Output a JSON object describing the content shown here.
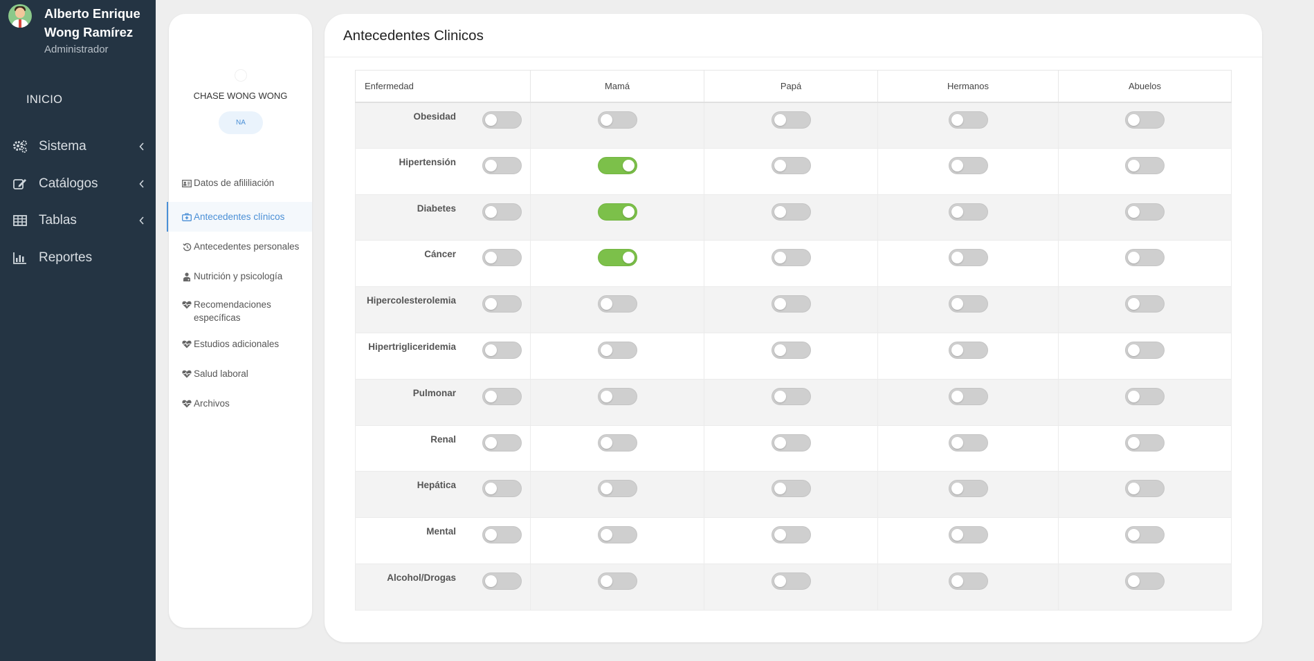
{
  "user": {
    "name": "Alberto Enrique Wong Ramírez",
    "role": "Administrador"
  },
  "nav": {
    "inicio": "INICIO",
    "items": [
      {
        "label": "Sistema",
        "icon": "cogs-icon"
      },
      {
        "label": "Catálogos",
        "icon": "edit-icon"
      },
      {
        "label": "Tablas",
        "icon": "table-icon"
      },
      {
        "label": "Reportes",
        "icon": "bar-chart-icon"
      }
    ]
  },
  "patient": {
    "name": "CHASE WONG WONG",
    "badge": "NA",
    "menu": [
      {
        "label": "Datos de afililiación",
        "icon": "id-card-icon",
        "active": false
      },
      {
        "label": "Antecedentes clínicos",
        "icon": "medkit-icon",
        "active": true
      },
      {
        "label": "Antecedentes personales",
        "icon": "history-icon",
        "active": false
      },
      {
        "label": "Nutrición y psicología",
        "icon": "doctor-icon",
        "active": false
      },
      {
        "label": "Recomendaciones específicas",
        "icon": "heartbeat-icon",
        "active": false
      },
      {
        "label": "Estudios adicionales",
        "icon": "heartbeat-icon",
        "active": false
      },
      {
        "label": "Salud laboral",
        "icon": "heartbeat-icon",
        "active": false
      },
      {
        "label": "Archivos",
        "icon": "heartbeat-icon",
        "active": false
      }
    ]
  },
  "main": {
    "title": "Antecedentes Clinicos",
    "columns": [
      "Enfermedad",
      "Mamá",
      "Papá",
      "Hermanos",
      "Abuelos"
    ],
    "rows": [
      {
        "name": "Obesidad",
        "self": false,
        "mama": false,
        "papa": false,
        "hermanos": false,
        "abuelos": false
      },
      {
        "name": "Hipertensión",
        "self": false,
        "mama": true,
        "papa": false,
        "hermanos": false,
        "abuelos": false
      },
      {
        "name": "Diabetes",
        "self": false,
        "mama": true,
        "papa": false,
        "hermanos": false,
        "abuelos": false
      },
      {
        "name": "Cáncer",
        "self": false,
        "mama": true,
        "papa": false,
        "hermanos": false,
        "abuelos": false
      },
      {
        "name": "Hipercolesterolemia",
        "self": false,
        "mama": false,
        "papa": false,
        "hermanos": false,
        "abuelos": false
      },
      {
        "name": "Hipertrigliceridemia",
        "self": false,
        "mama": false,
        "papa": false,
        "hermanos": false,
        "abuelos": false
      },
      {
        "name": "Pulmonar",
        "self": false,
        "mama": false,
        "papa": false,
        "hermanos": false,
        "abuelos": false
      },
      {
        "name": "Renal",
        "self": false,
        "mama": false,
        "papa": false,
        "hermanos": false,
        "abuelos": false
      },
      {
        "name": "Hepática",
        "self": false,
        "mama": false,
        "papa": false,
        "hermanos": false,
        "abuelos": false
      },
      {
        "name": "Mental",
        "self": false,
        "mama": false,
        "papa": false,
        "hermanos": false,
        "abuelos": false
      },
      {
        "name": "Alcohol/Drogas",
        "self": false,
        "mama": false,
        "papa": false,
        "hermanos": false,
        "abuelos": false
      }
    ]
  },
  "colors": {
    "sidebar": "#243443",
    "accent": "#4a8fd6",
    "toggle_on": "#7cc04a",
    "toggle_off": "#cfcfcf"
  }
}
